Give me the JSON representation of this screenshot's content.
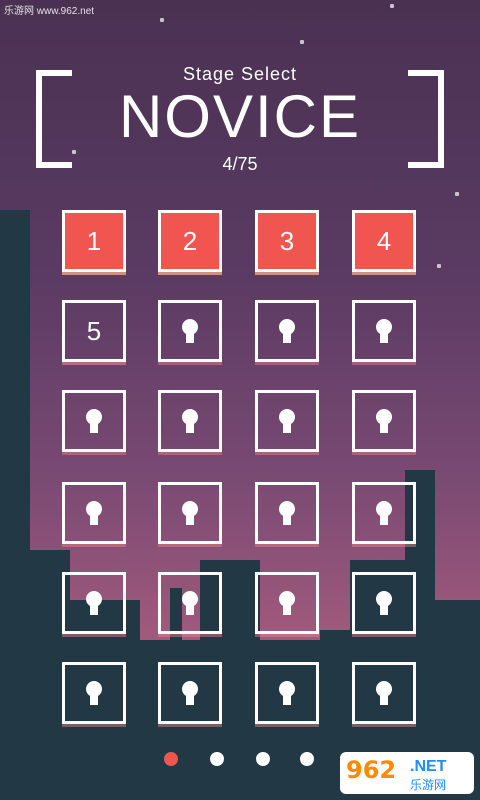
{
  "watermark": "乐游网 www.962.net",
  "header": {
    "subtitle": "Stage Select",
    "title": "NOVICE",
    "progress": "4/75"
  },
  "levels": [
    {
      "label": "1",
      "state": "cleared"
    },
    {
      "label": "2",
      "state": "cleared"
    },
    {
      "label": "3",
      "state": "cleared"
    },
    {
      "label": "4",
      "state": "cleared"
    },
    {
      "label": "5",
      "state": "open"
    },
    {
      "label": "",
      "state": "locked"
    },
    {
      "label": "",
      "state": "locked"
    },
    {
      "label": "",
      "state": "locked"
    },
    {
      "label": "",
      "state": "locked"
    },
    {
      "label": "",
      "state": "locked"
    },
    {
      "label": "",
      "state": "locked"
    },
    {
      "label": "",
      "state": "locked"
    },
    {
      "label": "",
      "state": "locked"
    },
    {
      "label": "",
      "state": "locked"
    },
    {
      "label": "",
      "state": "locked"
    },
    {
      "label": "",
      "state": "locked"
    },
    {
      "label": "",
      "state": "locked"
    },
    {
      "label": "",
      "state": "locked"
    },
    {
      "label": "",
      "state": "locked"
    },
    {
      "label": "",
      "state": "locked"
    },
    {
      "label": "",
      "state": "locked"
    },
    {
      "label": "",
      "state": "locked"
    },
    {
      "label": "",
      "state": "locked"
    },
    {
      "label": "",
      "state": "locked"
    }
  ],
  "pager": {
    "pages": 4,
    "current": 1
  },
  "logo": {
    "number": "962",
    "net": ".NET",
    "cn": "乐游网"
  },
  "colors": {
    "accent": "#f0564f",
    "skyline": "#233845"
  }
}
